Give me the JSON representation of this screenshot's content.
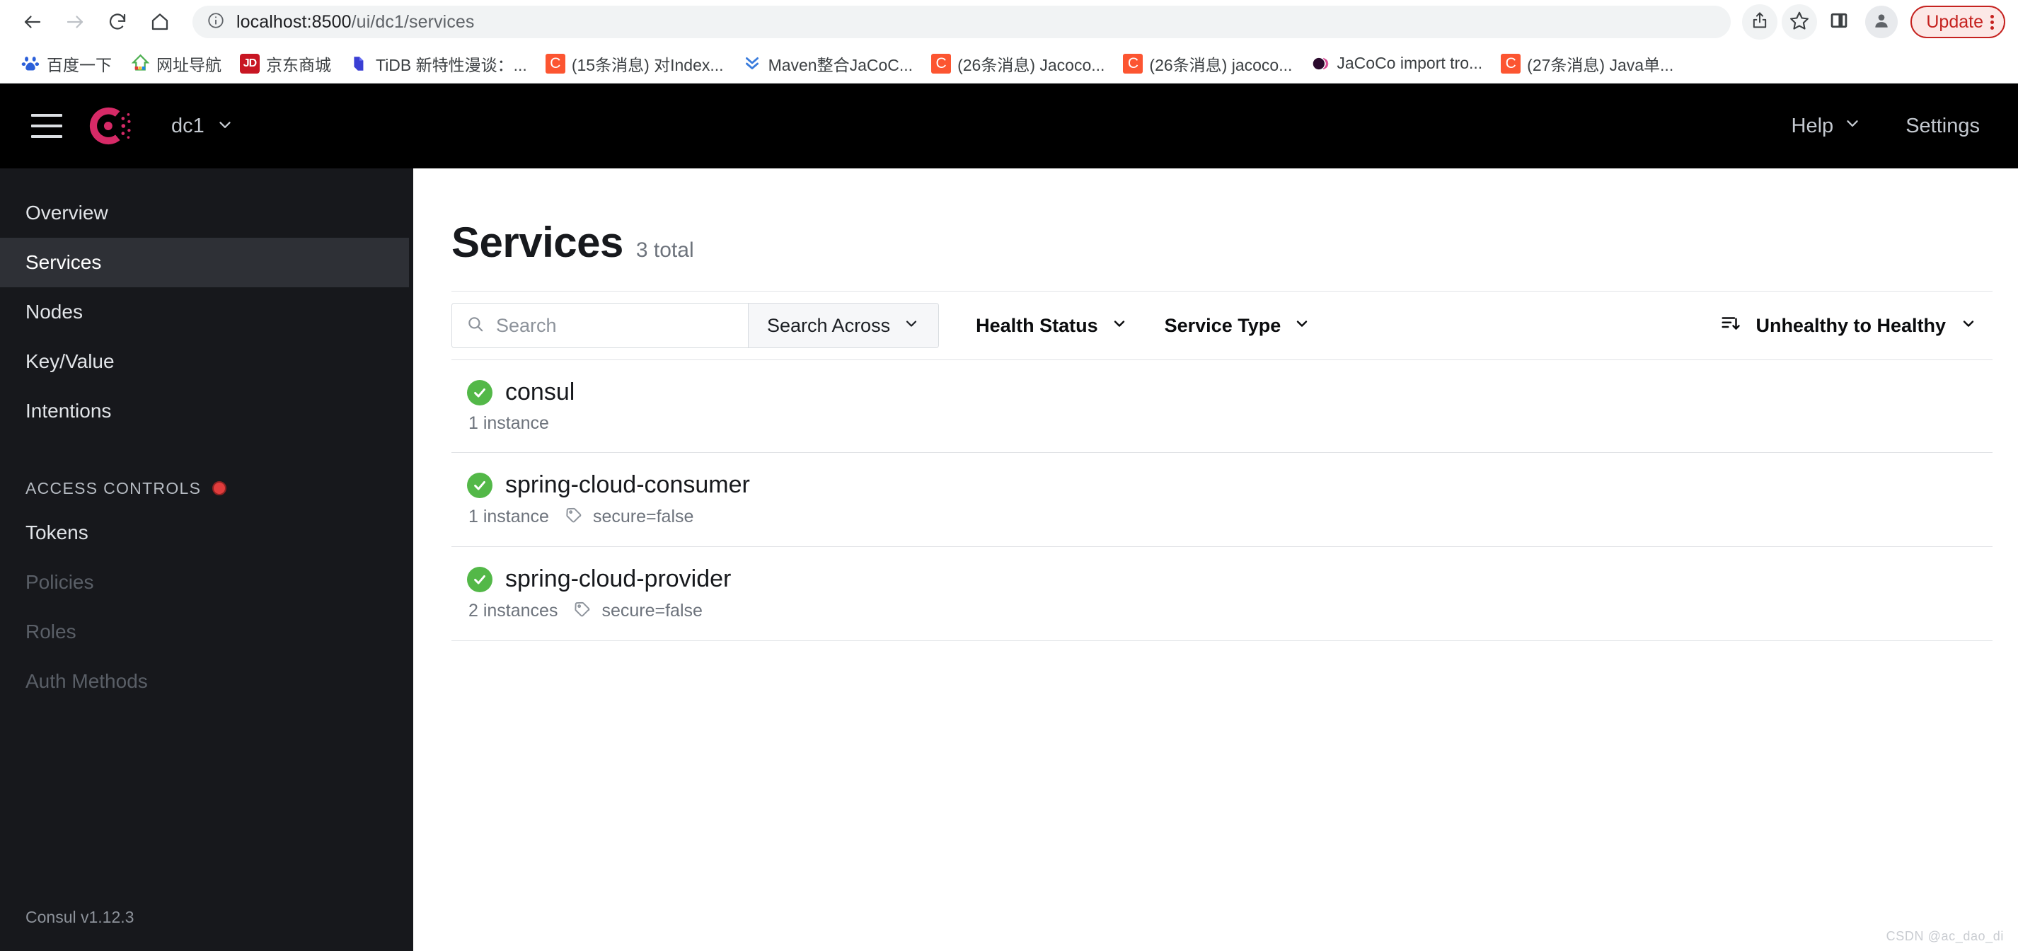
{
  "browser": {
    "url_host": "localhost:8500",
    "url_path": "/ui/dc1/services",
    "back_icon": "back-arrow-icon",
    "forward_icon": "forward-arrow-icon",
    "reload_icon": "reload-icon",
    "home_icon": "home-icon",
    "site_info_icon": "site-info-icon",
    "share_icon": "share-icon",
    "bookmark_icon": "star-icon",
    "sidepanel_icon": "side-panel-icon",
    "profile_icon": "profile-avatar-icon",
    "update_label": "Update",
    "menu_icon": "three-dot-menu-icon",
    "update_accent": "#c5221f"
  },
  "bookmarks": [
    {
      "label": "百度一下",
      "favicon": "baidu-icon"
    },
    {
      "label": "网址导航",
      "favicon": "2345-icon"
    },
    {
      "label": "京东商城",
      "favicon": "jd-icon",
      "badge": "JD"
    },
    {
      "label": "TiDB 新特性漫谈：...",
      "favicon": "tidb-icon"
    },
    {
      "label": "(15条消息) 对Index...",
      "favicon": "csdn-icon",
      "badge": "C"
    },
    {
      "label": "Maven整合JaCoC...",
      "favicon": "maven-icon"
    },
    {
      "label": "(26条消息) Jacoco...",
      "favicon": "csdn-icon",
      "badge": "C"
    },
    {
      "label": "(26条消息) jacoco...",
      "favicon": "csdn-icon",
      "badge": "C"
    },
    {
      "label": "JaCoCo import tro...",
      "favicon": "jacoco-icon"
    },
    {
      "label": "(27条消息) Java单...",
      "favicon": "csdn-icon",
      "badge": "C"
    }
  ],
  "app_header": {
    "menu_icon": "hamburger-menu-icon",
    "logo_icon": "consul-logo-icon",
    "logo_color": "#d62a67",
    "datacenter": "dc1",
    "datacenter_caret": "chevron-down-icon",
    "help_label": "Help",
    "help_caret": "chevron-down-icon",
    "settings_label": "Settings"
  },
  "sidebar": {
    "items": [
      {
        "label": "Overview",
        "active": false,
        "disabled": false
      },
      {
        "label": "Services",
        "active": true,
        "disabled": false
      },
      {
        "label": "Nodes",
        "active": false,
        "disabled": false
      },
      {
        "label": "Key/Value",
        "active": false,
        "disabled": false
      },
      {
        "label": "Intentions",
        "active": false,
        "disabled": false
      }
    ],
    "section_label": "ACCESS CONTROLS",
    "section_dot_icon": "acl-status-dot-icon",
    "section_dot_color": "#e03c3c",
    "acl_items": [
      {
        "label": "Tokens",
        "disabled": false
      },
      {
        "label": "Policies",
        "disabled": true
      },
      {
        "label": "Roles",
        "disabled": true
      },
      {
        "label": "Auth Methods",
        "disabled": true
      }
    ],
    "footer_version": "Consul v1.12.3"
  },
  "main": {
    "title": "Services",
    "subtitle": "3 total",
    "filters": {
      "search_placeholder": "Search",
      "search_value": "",
      "search_icon": "search-icon",
      "search_across_label": "Search Across",
      "search_across_caret": "chevron-down-icon",
      "health_status_label": "Health Status",
      "health_status_caret": "chevron-down-icon",
      "service_type_label": "Service Type",
      "service_type_caret": "chevron-down-icon",
      "sort_icon": "sort-descending-icon",
      "sort_label": "Unhealthy to Healthy",
      "sort_caret": "chevron-down-icon"
    },
    "services": [
      {
        "name": "consul",
        "status": "healthy",
        "status_icon": "check-circle-icon",
        "status_color": "#53b848",
        "instances": "1 instance",
        "tag": null,
        "tag_icon": "tag-icon"
      },
      {
        "name": "spring-cloud-consumer",
        "status": "healthy",
        "status_icon": "check-circle-icon",
        "status_color": "#53b848",
        "instances": "1 instance",
        "tag": "secure=false",
        "tag_icon": "tag-icon"
      },
      {
        "name": "spring-cloud-provider",
        "status": "healthy",
        "status_icon": "check-circle-icon",
        "status_color": "#53b848",
        "instances": "2 instances",
        "tag": "secure=false",
        "tag_icon": "tag-icon"
      }
    ],
    "watermark": "CSDN @ac_dao_di"
  }
}
